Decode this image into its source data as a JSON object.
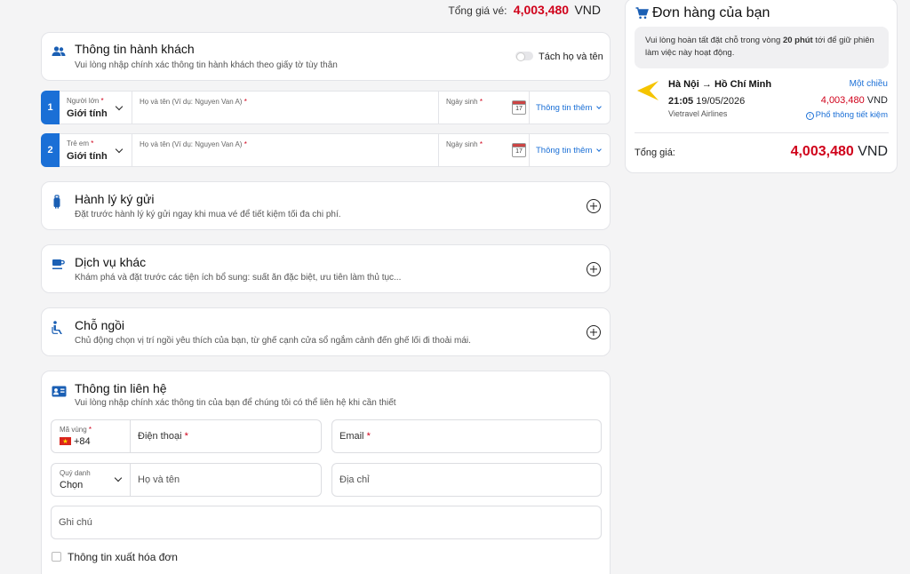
{
  "header": {
    "total_label": "Tổng giá vé:",
    "total_amount": "4,003,480",
    "currency": "VND"
  },
  "passenger_info": {
    "title": "Thông tin hành khách",
    "subtitle": "Vui lòng nhập chính xác thông tin hành khách theo giấy tờ tùy thân",
    "split_name_label": "Tách họ và tên",
    "rows": [
      {
        "number": "1",
        "type": "Người lớn",
        "gender_value": "Giới tính",
        "name_placeholder": "Họ và tên (Ví dụ: Nguyen Van A)",
        "dob_label": "Ngày sinh",
        "more_label": "Thông tin thêm"
      },
      {
        "number": "2",
        "type": "Trẻ em",
        "gender_value": "Giới tính",
        "name_placeholder": "Họ và tên (Ví dụ: Nguyen Van A)",
        "dob_label": "Ngày sinh",
        "more_label": "Thông tin thêm"
      }
    ],
    "calendar_day": "17"
  },
  "sections": {
    "baggage": {
      "title": "Hành lý ký gửi",
      "subtitle": "Đặt trước hành lý ký gửi ngay khi mua vé để tiết kiệm tối đa chi phí."
    },
    "services": {
      "title": "Dịch vụ khác",
      "subtitle": "Khám phá và đặt trước các tiện ích bổ sung: suất ăn đặc biệt, ưu tiên làm thủ tục..."
    },
    "seats": {
      "title": "Chỗ ngồi",
      "subtitle": "Chủ động chọn vị trí ngồi yêu thích của bạn, từ ghế cạnh cửa sổ ngắm cảnh đến ghế lối đi thoải mái."
    }
  },
  "contact": {
    "title": "Thông tin liên hệ",
    "subtitle": "Vui lòng nhập chính xác thông tin của bạn để chúng tôi có thể liên hệ khi cần thiết",
    "area_code_label": "Mã vùng",
    "area_code_value": "+84",
    "phone_label": "Điện thoại",
    "email_label": "Email",
    "title_label": "Quý danh",
    "title_value": "Chọn",
    "name_label": "Họ và tên",
    "address_label": "Địa chỉ",
    "note_label": "Ghi chú",
    "invoice_label": "Thông tin xuất hóa đơn"
  },
  "order": {
    "title": "Đơn hàng của bạn",
    "notice_prefix": "Vui lòng hoàn tất đặt chỗ trong vòng ",
    "notice_bold": "20 phút",
    "notice_suffix": " tới để giữ phiên làm việc này hoạt động.",
    "route": "Hà Nội → Hồ Chí Minh",
    "trip_type": "Một chiều",
    "time": "21:05",
    "date": "19/05/2026",
    "price": "4,003,480",
    "currency": "VND",
    "airline": "Vietravel Airlines",
    "details_link": "Phổ thông tiết kiệm",
    "total_label": "Tổng giá:",
    "total_amount": "4,003,480",
    "total_currency": "VND"
  },
  "colors": {
    "accent": "#1a6fd6",
    "price": "#d0021b",
    "airline_logo": "#f5c400"
  }
}
